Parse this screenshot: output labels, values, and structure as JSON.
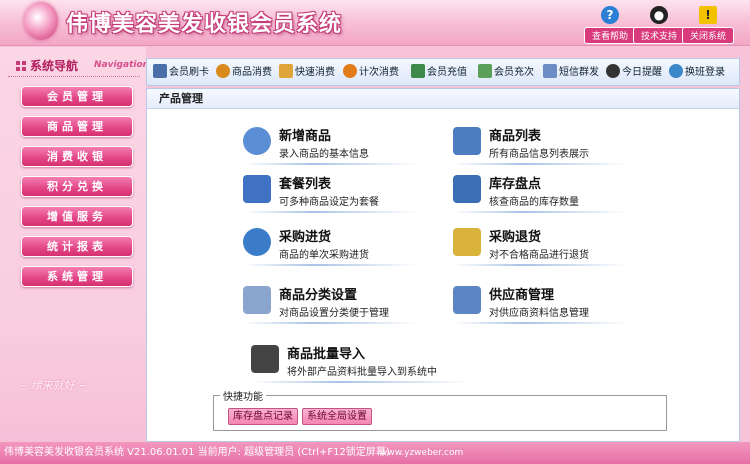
{
  "app": {
    "title": "伟博美容美发收银会员系统"
  },
  "header_tools": [
    {
      "label": "查看帮助",
      "icon": "help-icon",
      "glyph": "?",
      "color": "#2b7fd4"
    },
    {
      "label": "技术支持",
      "icon": "qq-penguin-icon",
      "glyph": "●",
      "color": "#222222"
    },
    {
      "label": "关闭系统",
      "icon": "warning-icon",
      "glyph": "!",
      "color": "#e8b400"
    }
  ],
  "sidebar": {
    "title": "系统导航",
    "subtitle": "Navigation",
    "items": [
      {
        "label": "会员管理"
      },
      {
        "label": "商品管理"
      },
      {
        "label": "消费收银"
      },
      {
        "label": "积分兑换"
      },
      {
        "label": "增值服务"
      },
      {
        "label": "统计报表"
      },
      {
        "label": "系统管理"
      }
    ],
    "decoration": "~ 缘来就好 ~"
  },
  "toolbar": [
    {
      "label": "会员刷卡",
      "icon": "card-icon",
      "color": "#4a6fa8"
    },
    {
      "label": "商品消费",
      "icon": "money-bag-icon",
      "color": "#d88b1c"
    },
    {
      "label": "快速消费",
      "icon": "fast-hand-icon",
      "color": "#e0a53a"
    },
    {
      "label": "计次消费",
      "icon": "counter-icon",
      "color": "#e27b1a"
    },
    {
      "label": "会员充值",
      "icon": "recharge-icon",
      "color": "#3d8a4a"
    },
    {
      "label": "会员充次",
      "icon": "chart-icon",
      "color": "#5aa05a"
    },
    {
      "label": "短信群发",
      "icon": "mail-icon",
      "color": "#6b8cc4"
    },
    {
      "label": "今日提醒",
      "icon": "clock-icon",
      "color": "#333333"
    },
    {
      "label": "换班登录",
      "icon": "switch-icon",
      "color": "#3b87c8"
    }
  ],
  "main": {
    "section_title": "产品管理",
    "entries": [
      {
        "title": "新增商品",
        "desc": "录入商品的基本信息",
        "icon": "add-product-icon",
        "color": "#5a8fd6"
      },
      {
        "title": "商品列表",
        "desc": "所有商品信息列表展示",
        "icon": "product-list-icon",
        "color": "#4c7dc0"
      },
      {
        "title": "套餐列表",
        "desc": "可多种商品设定为套餐",
        "icon": "package-icon",
        "color": "#3f72c2"
      },
      {
        "title": "库存盘点",
        "desc": "核查商品的库存数量",
        "icon": "inventory-icon",
        "color": "#3b6fb5"
      },
      {
        "title": "采购进货",
        "desc": "商品的单次采购进货",
        "icon": "purchase-icon",
        "color": "#3a7cc8"
      },
      {
        "title": "采购退货",
        "desc": "对不合格商品进行退货",
        "icon": "return-icon",
        "color": "#d9b23a"
      },
      {
        "title": "商品分类设置",
        "desc": "对商品设置分类便于管理",
        "icon": "category-icon",
        "color": "#8aa6cf"
      },
      {
        "title": "供应商管理",
        "desc": "对供应商资料信息管理",
        "icon": "supplier-icon",
        "color": "#5c86c3"
      },
      {
        "title": "商品批量导入",
        "desc": "将外部产品资料批量导入到系统中",
        "icon": "import-laptop-icon",
        "color": "#444444"
      }
    ],
    "quick": {
      "label": "快捷功能",
      "buttons": [
        {
          "label": "库存盘点记录"
        },
        {
          "label": "系统全局设置"
        }
      ]
    }
  },
  "status": {
    "text": "伟博美容美发收银会员系统 V21.06.01.01 当前用户: 超级管理员 (Ctrl+F12锁定屏幕)",
    "url": "www.yzweber.com"
  }
}
